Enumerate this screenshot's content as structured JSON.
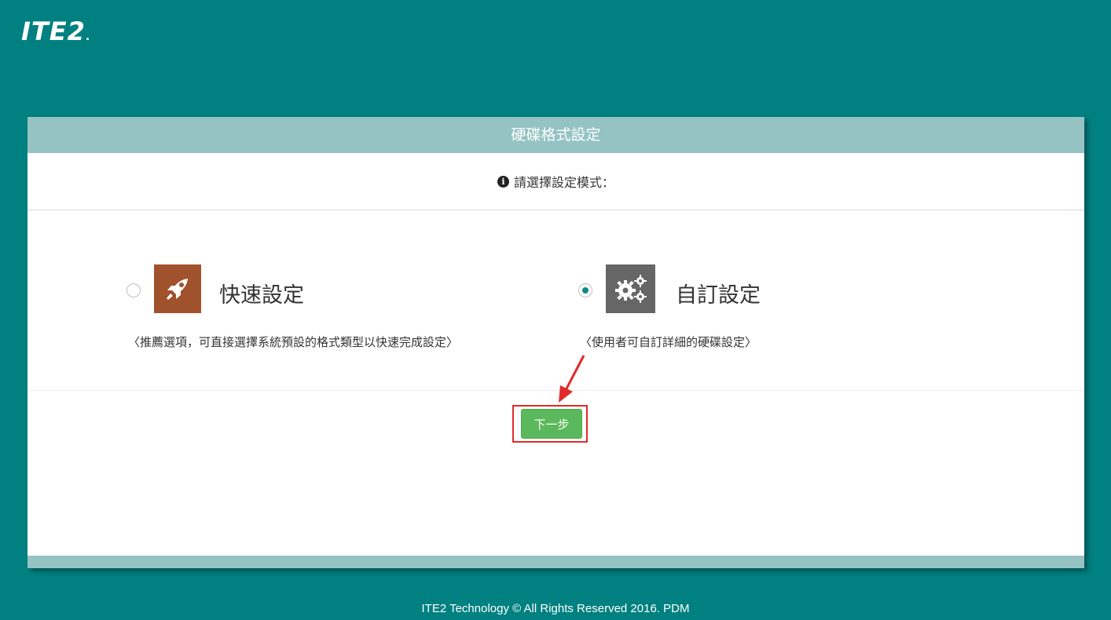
{
  "brand": {
    "logo_text": "ITE2",
    "logo_dot": "."
  },
  "panel": {
    "title": "硬碟格式設定",
    "prompt": "請選擇設定模式：",
    "prompt_icon": "info-icon"
  },
  "options": [
    {
      "title": "快速設定",
      "description": "〈推薦選項，可直接選擇系統預設的格式類型以快速完成設定〉",
      "icon": "rocket-icon",
      "icon_bg": "#a0522d",
      "selected": false
    },
    {
      "title": "自訂設定",
      "description": "〈使用者可自訂詳細的硬碟設定〉",
      "icon": "gears-icon",
      "icon_bg": "#666666",
      "selected": true
    }
  ],
  "actions": {
    "next_label": "下一步"
  },
  "footer": {
    "copyright": "ITE2 Technology © All Rights Reserved 2016. PDM"
  },
  "colors": {
    "background": "#008080",
    "header": "#95c3c4",
    "next_button": "#5cb85c",
    "highlight": "#e12a2a",
    "radio_selected": "#0e8a84"
  }
}
